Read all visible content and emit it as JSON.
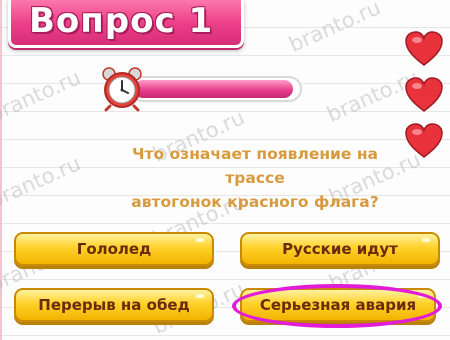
{
  "header": {
    "title": "Вопрос 1"
  },
  "timer": {
    "remaining_fraction": 0.97
  },
  "lives": {
    "count": 3,
    "color": "#e8323c"
  },
  "question": {
    "line1": "Что означает появление на трассе",
    "line2": "автогонок красного флага?"
  },
  "answers": [
    {
      "label": "Гололед"
    },
    {
      "label": "Русские идут"
    },
    {
      "label": "Перерыв на обед"
    },
    {
      "label": "Серьезная авария",
      "highlighted": true
    }
  ],
  "watermark": {
    "text": "branto.ru"
  },
  "colors": {
    "banner": "#ec3f88",
    "timer_fill": "#e23a86",
    "question_text": "#d89a3e",
    "button": "#ffd12a",
    "button_text": "#6a2a0c",
    "highlight_ring": "#e21dd7"
  }
}
